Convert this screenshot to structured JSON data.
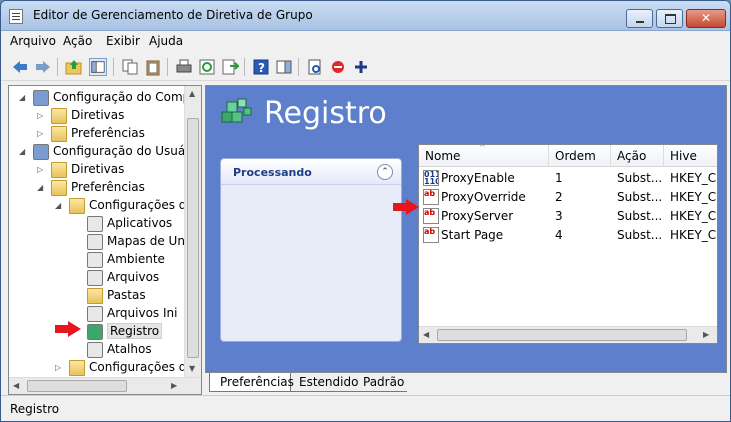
{
  "window": {
    "title": "Editor de Gerenciamento de Diretiva de Grupo"
  },
  "menu": [
    "Arquivo",
    "Ação",
    "Exibir",
    "Ajuda"
  ],
  "tree": {
    "items": [
      {
        "label": "Configuração do Compu",
        "level": 0,
        "expander": "collapse",
        "icon": "computer-icon"
      },
      {
        "label": "Diretivas",
        "level": 1,
        "expander": "expand",
        "icon": "folder-icon"
      },
      {
        "label": "Preferências",
        "level": 1,
        "expander": "expand",
        "icon": "folder-icon"
      },
      {
        "label": "Configuração do Usuário",
        "level": 0,
        "expander": "collapse",
        "icon": "user-icon"
      },
      {
        "label": "Diretivas",
        "level": 1,
        "expander": "expand",
        "icon": "folder-icon"
      },
      {
        "label": "Preferências",
        "level": 1,
        "expander": "collapse",
        "icon": "folder-icon"
      },
      {
        "label": "Configurações do",
        "level": 2,
        "expander": "collapse",
        "icon": "folder-icon"
      },
      {
        "label": "Aplicativos",
        "level": 3,
        "expander": "",
        "icon": "applications-icon"
      },
      {
        "label": "Mapas de Uni",
        "level": 3,
        "expander": "",
        "icon": "drive-maps-icon"
      },
      {
        "label": "Ambiente",
        "level": 3,
        "expander": "",
        "icon": "environment-icon"
      },
      {
        "label": "Arquivos",
        "level": 3,
        "expander": "",
        "icon": "files-icon"
      },
      {
        "label": "Pastas",
        "level": 3,
        "expander": "",
        "icon": "folders-icon"
      },
      {
        "label": "Arquivos Ini",
        "level": 3,
        "expander": "",
        "icon": "ini-files-icon"
      },
      {
        "label": "Registro",
        "level": 3,
        "expander": "",
        "icon": "registry-icon",
        "selected": true
      },
      {
        "label": "Atalhos",
        "level": 3,
        "expander": "",
        "icon": "shortcuts-icon"
      },
      {
        "label": "Configurações do",
        "level": 2,
        "expander": "expand",
        "icon": "control-panel-folder-icon"
      }
    ]
  },
  "main": {
    "heading": "Registro",
    "processing_panel": {
      "title": "Processando"
    },
    "list": {
      "columns": [
        "Nome",
        "Ordem",
        "Ação",
        "Hive"
      ],
      "rows": [
        {
          "name": "ProxyEnable",
          "order": "1",
          "action": "Subst...",
          "hive": "HKEY_CU",
          "type": "reg-binary"
        },
        {
          "name": "ProxyOverride",
          "order": "2",
          "action": "Subst...",
          "hive": "HKEY_CU",
          "type": "reg-string"
        },
        {
          "name": "ProxyServer",
          "order": "3",
          "action": "Subst...",
          "hive": "HKEY_CU",
          "type": "reg-string"
        },
        {
          "name": "Start Page",
          "order": "4",
          "action": "Subst...",
          "hive": "HKEY_CU",
          "type": "reg-string"
        }
      ]
    },
    "tabs": [
      "Preferências",
      "Estendido",
      "Padrão"
    ]
  },
  "status": {
    "text": "Registro"
  },
  "colors": {
    "pane_blue": "#5d7fcc",
    "arrow_red": "#e8141e"
  }
}
